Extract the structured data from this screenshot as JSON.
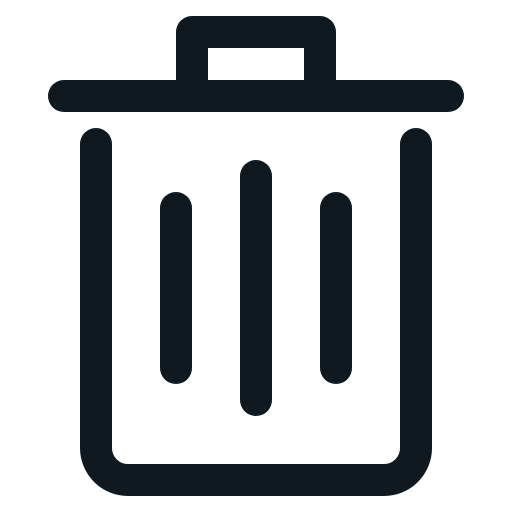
{
  "icon": {
    "name": "trash-icon",
    "stroke_color": "#111920",
    "background_color": "#ffffff"
  }
}
